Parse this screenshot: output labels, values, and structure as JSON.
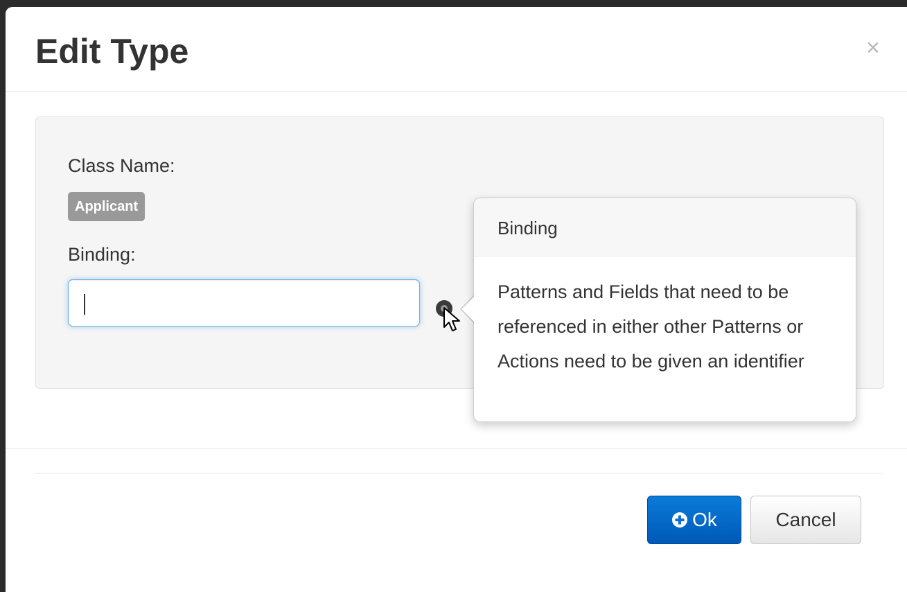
{
  "modal": {
    "title": "Edit Type",
    "close_label": "×"
  },
  "form": {
    "class_name_label": "Class Name:",
    "class_name_badge": "Applicant",
    "binding_label": "Binding:",
    "binding_value": ""
  },
  "popover": {
    "title": "Binding",
    "content": "Patterns and Fields that need to be referenced in either other Patterns or Actions need to be given an identifier"
  },
  "footer": {
    "ok_label": "Ok",
    "cancel_label": "Cancel"
  },
  "icons": {
    "help": "question-circle-icon",
    "ok": "plus-circle-icon",
    "cursor": "mouse-pointer-icon"
  },
  "colors": {
    "primary": "#0a6fd0",
    "input_focus": "#66afe9",
    "badge": "#999999"
  }
}
